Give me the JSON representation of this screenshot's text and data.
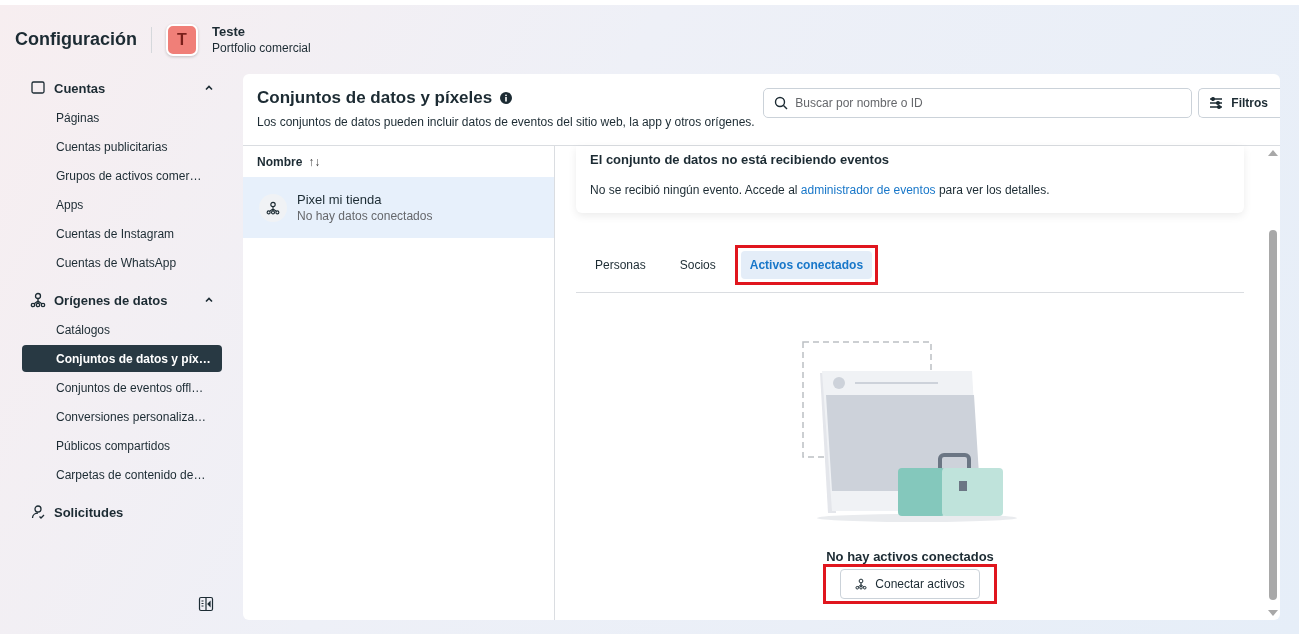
{
  "header": {
    "title": "Configuración",
    "portfolio": {
      "initial": "T",
      "name": "Teste",
      "subtitle": "Portfolio comercial"
    }
  },
  "sidebar": {
    "sections": [
      {
        "label": "Cuentas",
        "kind": "accounts",
        "expanded": true,
        "items": [
          {
            "label": "Páginas",
            "selected": false
          },
          {
            "label": "Cuentas publicitarias",
            "selected": false
          },
          {
            "label": "Grupos de activos comer…",
            "selected": false
          },
          {
            "label": "Apps",
            "selected": false
          },
          {
            "label": "Cuentas de Instagram",
            "selected": false
          },
          {
            "label": "Cuentas de WhatsApp",
            "selected": false
          }
        ]
      },
      {
        "label": "Orígenes de datos",
        "kind": "data",
        "expanded": true,
        "items": [
          {
            "label": "Catálogos",
            "selected": false
          },
          {
            "label": "Conjuntos de datos y píx…",
            "selected": true
          },
          {
            "label": "Conjuntos de eventos offl…",
            "selected": false
          },
          {
            "label": "Conversiones personaliza…",
            "selected": false
          },
          {
            "label": "Públicos compartidos",
            "selected": false
          },
          {
            "label": "Carpetas de contenido de…",
            "selected": false
          }
        ]
      },
      {
        "label": "Solicitudes",
        "kind": "requests"
      }
    ]
  },
  "page": {
    "title": "Conjuntos de datos y píxeles",
    "description": "Los conjuntos de datos pueden incluir datos de eventos del sitio web, la app y otros orígenes.",
    "search": {
      "placeholder": "Buscar por nombre o ID"
    },
    "filter_button": "Filtros"
  },
  "list": {
    "column": "Nombre",
    "sort_glyph": "↑↓",
    "rows": [
      {
        "name": "Pixel mi tienda",
        "status": "No hay datos conectados",
        "selected": true
      }
    ]
  },
  "detail": {
    "notice": {
      "title": "El conjunto de datos no está recibiendo eventos",
      "text_before": "No se recibió ningún evento. Accede al",
      "link": "administrador de eventos",
      "text_after": "para ver los detalles."
    },
    "tabs": [
      {
        "label": "Personas",
        "selected": false,
        "highlighted": false
      },
      {
        "label": "Socios",
        "selected": false,
        "highlighted": false
      },
      {
        "label": "Activos conectados",
        "selected": true,
        "highlighted": true
      }
    ],
    "empty_state": {
      "title": "No hay activos conectados",
      "button": "Conectar activos",
      "button_highlighted": true
    }
  }
}
